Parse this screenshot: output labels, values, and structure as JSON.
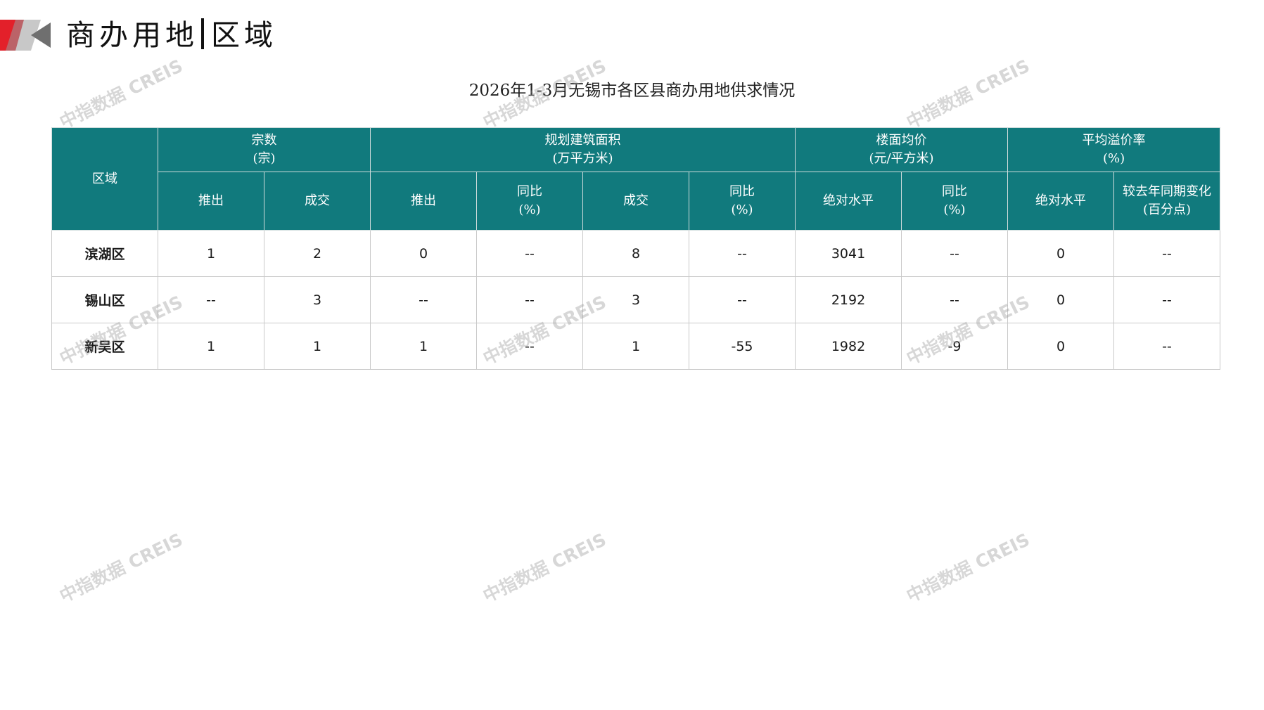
{
  "header": {
    "title_left": "商办用地",
    "title_right": "区域"
  },
  "table_title": "2026年1-3月无锡市各区县商办用地供求情况",
  "watermark": "中指数据 CREIS",
  "colors": {
    "header_bg": "#117a7d",
    "logo_red": "#e3202a",
    "logo_gray": "#7d7d7d"
  },
  "table": {
    "group_headers": {
      "region": "区域",
      "count": "宗数\n(宗)",
      "area": "规划建筑面积\n(万平方米)",
      "price": "楼面均价\n(元/平方米)",
      "premium": "平均溢价率\n(%)"
    },
    "sub_headers": [
      "推出",
      "成交",
      "推出",
      "同比\n(%)",
      "成交",
      "同比\n(%)",
      "绝对水平",
      "同比\n(%)",
      "绝对水平",
      "较去年同期变化\n(百分点)"
    ],
    "rows": [
      {
        "region": "滨湖区",
        "cells": [
          "1",
          "2",
          "0",
          "--",
          "8",
          "--",
          "3041",
          "--",
          "0",
          "--"
        ]
      },
      {
        "region": "锡山区",
        "cells": [
          "--",
          "3",
          "--",
          "--",
          "3",
          "--",
          "2192",
          "--",
          "0",
          "--"
        ]
      },
      {
        "region": "新吴区",
        "cells": [
          "1",
          "1",
          "1",
          "--",
          "1",
          "-55",
          "1982",
          "-9",
          "0",
          "--"
        ]
      }
    ]
  }
}
